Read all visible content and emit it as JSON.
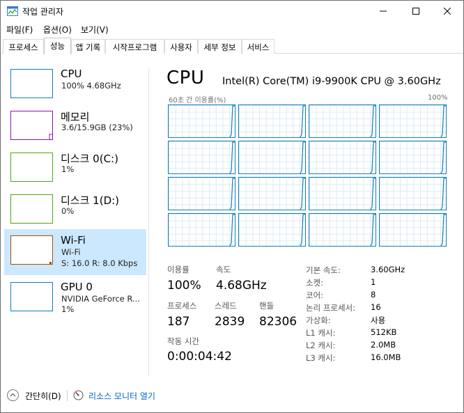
{
  "window": {
    "title": "작업 관리자"
  },
  "menu": [
    "파일(F)",
    "옵션(O)",
    "보기(V)"
  ],
  "tabs": [
    "프로세스",
    "성능",
    "앱 기록",
    "시작프로그램",
    "사용자",
    "세부 정보",
    "서비스"
  ],
  "active_tab": "성능",
  "devices": [
    {
      "name": "CPU",
      "line1": "100%  4.68GHz",
      "line2": "",
      "color": "#117dbb",
      "selected": false
    },
    {
      "name": "메모리",
      "line1": "3.6/15.9GB (23%)",
      "line2": "",
      "color": "#8b12ae",
      "selected": false
    },
    {
      "name": "디스크 0(C:)",
      "line1": "1%",
      "line2": "",
      "color": "#4da60c",
      "selected": false
    },
    {
      "name": "디스크 1(D:)",
      "line1": "0%",
      "line2": "",
      "color": "#4da60c",
      "selected": false
    },
    {
      "name": "Wi-Fi",
      "line1": "Wi-Fi",
      "line2": "S: 16.0  R: 8.0 Kbps",
      "color": "#a74f01",
      "selected": true
    },
    {
      "name": "GPU 0",
      "line1": "NVIDIA GeForce R...",
      "line2": "1%",
      "color": "#117dbb",
      "selected": false
    }
  ],
  "cpu": {
    "title": "CPU",
    "model": "Intel(R) Core(TM) i9-9900K CPU @ 3.60GHz",
    "graph_label_left": "60초 간 이용률(%)",
    "graph_label_right": "100%",
    "cores": 16,
    "accent": "#117dbb"
  },
  "stats": {
    "utilization_label": "이용률",
    "utilization": "100%",
    "speed_label": "속도",
    "speed": "4.68GHz",
    "processes_label": "프로세스",
    "processes": "187",
    "threads_label": "스레드",
    "threads": "2839",
    "handles_label": "핸들",
    "handles": "82306",
    "uptime_label": "작동 시간",
    "uptime": "0:00:04:42"
  },
  "info": [
    {
      "label": "기본 속도:",
      "value": "3.60GHz"
    },
    {
      "label": "소켓:",
      "value": "1"
    },
    {
      "label": "코어:",
      "value": "8"
    },
    {
      "label": "논리 프로세서:",
      "value": "16"
    },
    {
      "label": "가상화:",
      "value": "사용"
    },
    {
      "label": "L1 캐시:",
      "value": "512KB"
    },
    {
      "label": "L2 캐시:",
      "value": "2.0MB"
    },
    {
      "label": "L3 캐시:",
      "value": "16.0MB"
    }
  ],
  "footer": {
    "collapse": "간단히(D)",
    "monitor": "리소스 모니터 열기"
  }
}
